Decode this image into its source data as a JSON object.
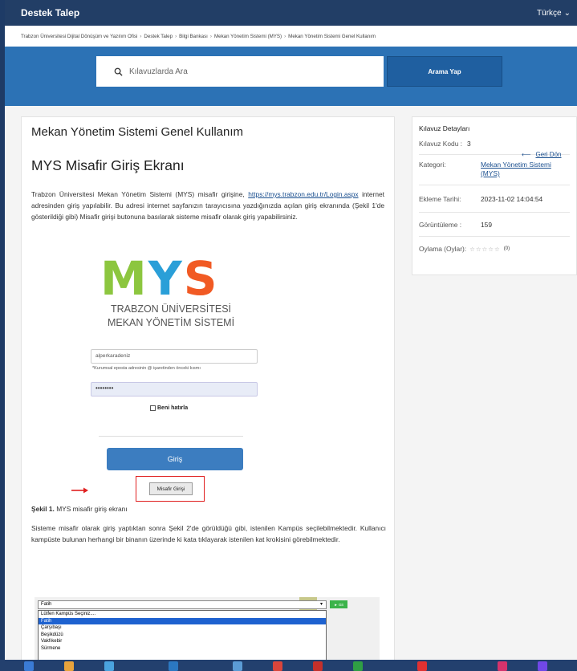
{
  "topbar": {
    "brand": "Destek Talep",
    "language": "Türkçe"
  },
  "breadcrumb": [
    "Trabzon Üniversitesi Dijital Dönüşüm ve Yazılım Ofisi",
    "Destek Talep",
    "Bilgi Bankası",
    "Mekan Yönetim Sistemi (MYS)",
    "Mekan Yönetim Sistemi Genel Kullanım"
  ],
  "search": {
    "placeholder": "Kılavuzlarda Ara",
    "button": "Arama Yap"
  },
  "article": {
    "title": "Mekan Yönetim Sistemi Genel Kullanım",
    "heading": "MYS Misafir Giriş Ekranı",
    "para1_start": "Trabzon Üniversitesi Mekan Yönetim Sistemi (MYS) misafir girişine, ",
    "para1_link": "https://mys.trabzon.edu.tr/Login.aspx",
    "para1_end": " internet adresinden giriş yapılabilir. Bu adresi internet sayfanızın tarayıcısına yazdığınızda açılan giriş ekranında (Şekil 1'de gösterildiği gibi) Misafir girişi butonuna basılarak sisteme misafir olarak giriş yapabilirsiniz.",
    "figure1": {
      "logo_m": "M",
      "logo_y": "Y",
      "logo_s": "S",
      "logo_line1": "TRABZON ÜNİVERSİTESİ",
      "logo_line2": "MEKAN YÖNETİM SİSTEMİ",
      "username": "alperkaradeniz",
      "hint": "*Kurumsal eposta adresinin @ işaretinden önceki kısmı",
      "password": "••••••••",
      "remember": "Beni hatırla",
      "login": "Giriş",
      "guest": "Misafir Girişi"
    },
    "caption_bold": "Şekil 1.",
    "caption_rest": " MYS misafir giriş ekranı",
    "para2": "Sisteme misafir olarak giriş yaptıktan sonra Şekil 2'de görüldüğü gibi, istenilen Kampüs seçilebilmektedir. Kullanıcı kampüste bulunan herhangi bir binanın üzerinde ki kata tıklayarak istenilen kat krokisini görebilmektedir.",
    "figure2": {
      "dropdown_value": "Fatih",
      "go": "► Git",
      "options": [
        "Lütfen Kampüs Seçiniz....",
        "Fatih",
        "Çarşıbaşı",
        "Beşikdüzü",
        "Vakfıkebir",
        "Sürmene"
      ],
      "selected_index": 1
    }
  },
  "sidebar": {
    "title": "Kılavuz Detayları",
    "code_label": "Kılavuz Kodu :",
    "code_value": "3",
    "category_label": "Kategori:",
    "category_value": "Mekan Yönetim Sistemi (MYS)",
    "date_label": "Ekleme Tarihi:",
    "date_value": "2023-11-02 14:04:54",
    "views_label": "Görüntüleme :",
    "views_value": "159",
    "rating_label": "Oylama (Oylar):",
    "rating_stars": "☆☆☆☆☆",
    "rating_count": "(0)",
    "back": "Geri Dön"
  },
  "colors": {
    "topbar": "#223e66",
    "search_band": "#2c72b5",
    "link": "#1a4f8f",
    "guest_highlight": "#e02020"
  }
}
